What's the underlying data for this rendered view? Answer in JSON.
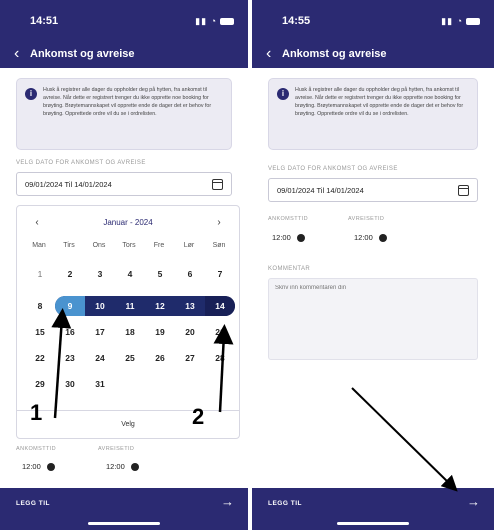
{
  "left": {
    "status": {
      "time": "14:51"
    },
    "nav": {
      "title": "Ankomst og avreise"
    },
    "info_text": "Husk å registrer alle dager du oppholder deg på hytten, fra ankomst til avreise. Når dette er registrert trenger du ikke opprette noe booking for brøyting. Brøytemannskapet vil opprette ende de dager det er behov for brøyting. Opprettede ordre vil du se i ordrelisten.",
    "date_label": "VELG DATO FOR ANKOMST OG AVREISE",
    "date_value": "09/01/2024 Til 14/01/2024",
    "calendar": {
      "month": "Januar - 2024",
      "prev": "‹",
      "next": "›",
      "weekdays": [
        "Man",
        "Tirs",
        "Ons",
        "Tors",
        "Fre",
        "Lør",
        "Søn"
      ],
      "rows": [
        [
          "1",
          "2",
          "3",
          "4",
          "5",
          "6",
          "7"
        ],
        [
          "8",
          "9",
          "10",
          "11",
          "12",
          "13",
          "14"
        ],
        [
          "15",
          "16",
          "17",
          "18",
          "19",
          "20",
          "21"
        ],
        [
          "22",
          "23",
          "24",
          "25",
          "26",
          "27",
          "28"
        ],
        [
          "29",
          "30",
          "31"
        ]
      ],
      "range_start": "9",
      "range_end": "14",
      "confirm_label": "Velg"
    },
    "arrival_label": "ANKOMSTTID",
    "arrival_value": "12:00",
    "departure_label": "AVREISETID",
    "departure_value": "12:00",
    "footer_label": "LEGG TIL",
    "footer_arrow": "→",
    "annotations": [
      "1",
      "2"
    ]
  },
  "right": {
    "status": {
      "time": "14:55"
    },
    "nav": {
      "title": "Ankomst og avreise"
    },
    "info_text": "Husk å registrer alle dager du oppholder deg på hytten, fra ankomst til avreise. Når dette er registrert trenger du ikke opprette noe booking for brøyting. Brøytemannskapet vil opprette ende de dager det er behov for brøyting. Opprettede ordre vil du se i ordrelisten.",
    "date_label": "VELG DATO FOR ANKOMST OG AVREISE",
    "date_value": "09/01/2024 Til 14/01/2024",
    "arrival_label": "ANKOMSTTID",
    "arrival_value": "12:00",
    "departure_label": "AVREISETID",
    "departure_value": "12:00",
    "comment_label": "KOMMENTAR",
    "comment_placeholder": "Skriv inn kommentaren din",
    "footer_label": "LEGG TIL",
    "footer_arrow": "→"
  },
  "colors": {
    "brand": "#2b2a72",
    "range": "#1f2b6b",
    "range_start": "#4a93cf"
  }
}
